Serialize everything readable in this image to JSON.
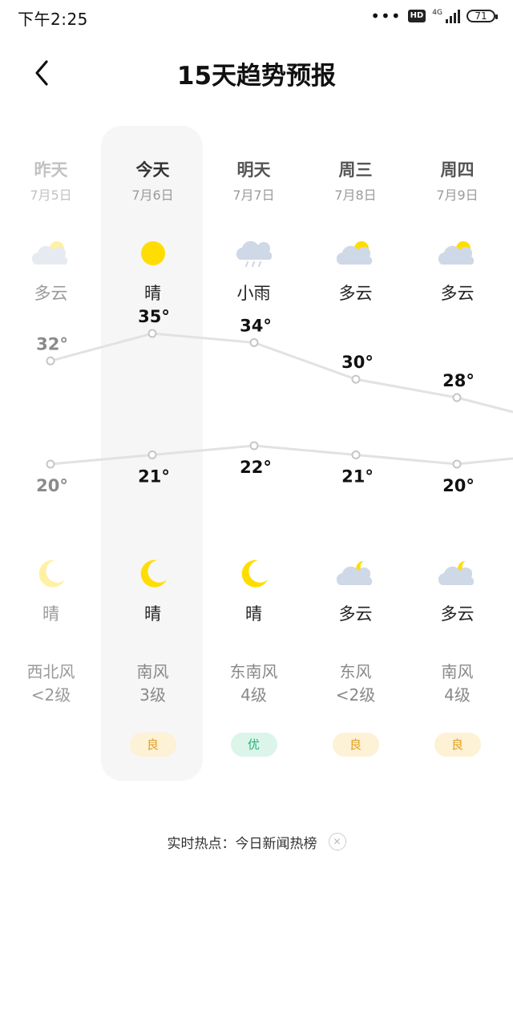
{
  "status_bar": {
    "time": "下午2:25",
    "dots": "•••",
    "hd_badge": "HD",
    "network": "4G",
    "battery": "71"
  },
  "header": {
    "title": "15天趋势预报",
    "back_icon": "chevron-left-icon"
  },
  "days": [
    {
      "label": "昨天",
      "date": "7月5日",
      "day_icon": "partly-cloudy-icon",
      "day_cond": "多云",
      "high": "32°",
      "low": "20°",
      "night_icon": "moon-icon",
      "night_cond": "晴",
      "wind_dir": "西北风",
      "wind_level": "<2级",
      "aqi": ""
    },
    {
      "label": "今天",
      "date": "7月6日",
      "day_icon": "sun-icon",
      "day_cond": "晴",
      "high": "35°",
      "low": "21°",
      "night_icon": "moon-icon",
      "night_cond": "晴",
      "wind_dir": "南风",
      "wind_level": "3级",
      "aqi": "良"
    },
    {
      "label": "明天",
      "date": "7月7日",
      "day_icon": "light-rain-icon",
      "day_cond": "小雨",
      "high": "34°",
      "low": "22°",
      "night_icon": "moon-icon",
      "night_cond": "晴",
      "wind_dir": "东南风",
      "wind_level": "4级",
      "aqi": "优"
    },
    {
      "label": "周三",
      "date": "7月8日",
      "day_icon": "partly-cloudy-icon",
      "day_cond": "多云",
      "high": "30°",
      "low": "21°",
      "night_icon": "cloudy-night-icon",
      "night_cond": "多云",
      "wind_dir": "东风",
      "wind_level": "<2级",
      "aqi": "良"
    },
    {
      "label": "周四",
      "date": "7月9日",
      "day_icon": "partly-cloudy-icon",
      "day_cond": "多云",
      "high": "28°",
      "low": "20°",
      "night_icon": "cloudy-night-icon",
      "night_cond": "多云",
      "wind_dir": "南风",
      "wind_level": "4级",
      "aqi": "良"
    }
  ],
  "chart_data": {
    "type": "line",
    "x": [
      "昨天",
      "今天",
      "明天",
      "周三",
      "周四"
    ],
    "series": [
      {
        "values": [
          32,
          35,
          34,
          30,
          28
        ]
      },
      {
        "values": [
          20,
          21,
          22,
          21,
          20
        ]
      }
    ]
  },
  "colors": {
    "aqi_good_bg": "#fdf1d6",
    "aqi_good_fg": "#e0a020",
    "aqi_excellent_bg": "#dcf5ea",
    "aqi_excellent_fg": "#29b07a",
    "sun": "#ffdd00",
    "moon": "#ffdd00",
    "moon_past": "#fff1a3",
    "cloud": "#cfd8e6"
  },
  "hotspot": {
    "text": "实时热点：今日新闻热榜",
    "close_icon": "close-icon"
  }
}
